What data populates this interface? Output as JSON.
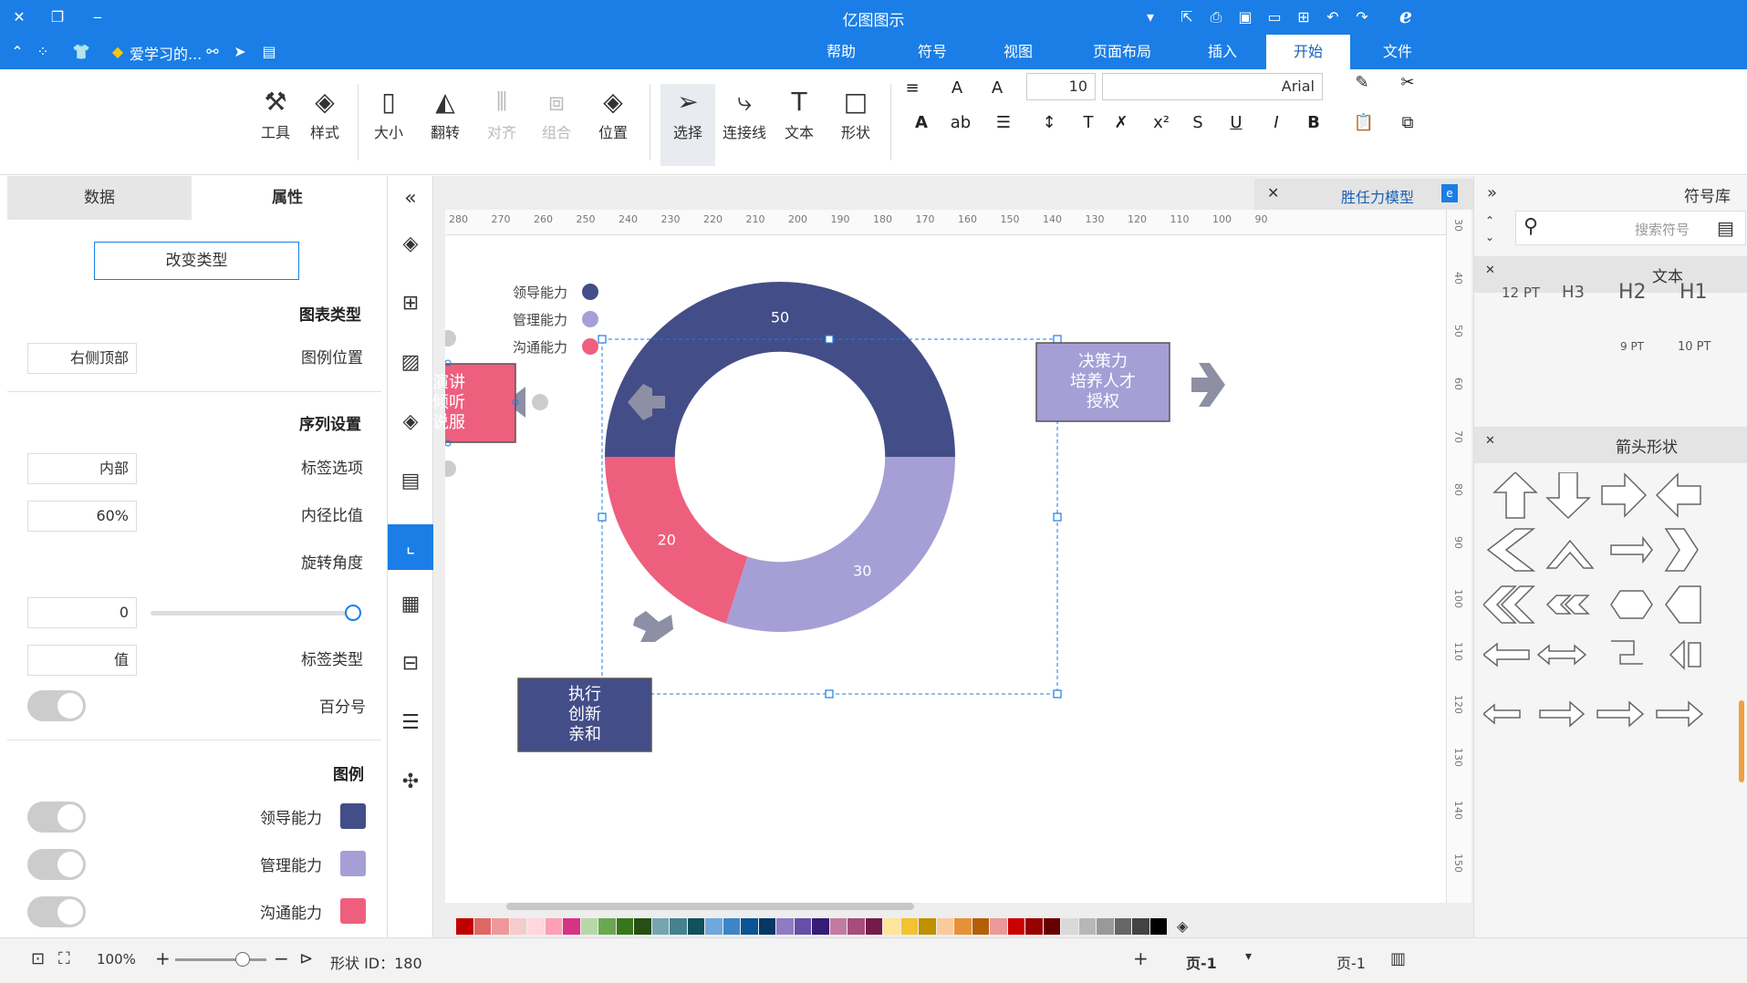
{
  "titlebar": {
    "title": "亿图图示"
  },
  "tabs": [
    {
      "label": "文件"
    },
    {
      "label": "开始"
    },
    {
      "label": "插入"
    },
    {
      "label": "页面布局"
    },
    {
      "label": "视图"
    },
    {
      "label": "符号"
    },
    {
      "label": "帮助"
    }
  ],
  "quickbar": {
    "user_label": "爱学习的..."
  },
  "ribbon": {
    "font_name": "Arial",
    "font_size": "10",
    "buttons": {
      "shape": "形状",
      "text": "文本",
      "connector": "连接线",
      "select": "选择",
      "position": "位置",
      "group": "组合",
      "align": "对齐",
      "flip": "翻转",
      "size": "大小",
      "style": "样式",
      "tools": "工具"
    }
  },
  "left_panel": {
    "tab_properties": "属性",
    "tab_data": "数据",
    "change_type": "改变类型",
    "chart_type_header": "图表类型",
    "legend_position_label": "图例位置",
    "legend_position_value": "右侧顶部",
    "series_header": "序列设置",
    "label_option_label": "标签选项",
    "label_option_value": "内部",
    "inner_ratio_label": "内径比值",
    "inner_ratio_value": "60%",
    "rotation_label": "旋转角度",
    "rotation_value": "0",
    "label_type_label": "标签类型",
    "label_type_value": "值",
    "percent_label": "百分号",
    "legend_header": "图例",
    "legend_items": [
      {
        "name": "领导能力",
        "color": "#434d87"
      },
      {
        "name": "管理能力",
        "color": "#a59fd6"
      },
      {
        "name": "沟通能力",
        "color": "#ee5f7e"
      }
    ]
  },
  "document_tab": {
    "title": "胜任力模型"
  },
  "ruler_top_labels": [
    "280",
    "270",
    "260",
    "250",
    "240",
    "230",
    "220",
    "210",
    "200",
    "190",
    "180",
    "170",
    "160",
    "150",
    "140",
    "130",
    "120",
    "110",
    "100",
    "90"
  ],
  "ruler_right_labels": [
    "30",
    "40",
    "50",
    "60",
    "70",
    "80",
    "90",
    "100",
    "110",
    "120",
    "130",
    "140",
    "150"
  ],
  "chart_data": {
    "type": "donut",
    "title": "",
    "inner_ratio": 0.6,
    "series": [
      {
        "name": "领导能力",
        "value": 50,
        "color": "#434d87"
      },
      {
        "name": "管理能力",
        "value": 30,
        "color": "#a59fd6"
      },
      {
        "name": "沟通能力",
        "value": 20,
        "color": "#ee5f7e"
      }
    ],
    "legend_position": "top-left",
    "value_labels": [
      "50",
      "30",
      "20"
    ]
  },
  "diagram": {
    "box_pink_text": "演讲\n倾听\n说服",
    "box_pink_color": "#ee5f7e",
    "box_purple_text": "决策力\n培养人才\n授权",
    "box_purple_color": "#a59fd6",
    "box_navy_text": "执行\n创新\n亲和",
    "box_navy_color": "#434d87"
  },
  "right_panel": {
    "title": "符号库",
    "search_placeholder": "搜索符号",
    "section_text": "文本",
    "section_arrows": "箭头形状",
    "text_samples": [
      "H1",
      "H2",
      "H3",
      "12 PT",
      "10 PT",
      "9 PT"
    ]
  },
  "statusbar": {
    "page_label": "页-1",
    "page_tab": "页-1",
    "shape_id": "形状 ID：180",
    "zoom": "100%"
  },
  "palette_colors": [
    "#c00000",
    "#e06666",
    "#e99",
    "#f4cccc",
    "#ffd7e0",
    "#ff9fb5",
    "#d63384",
    "#b6d7a8",
    "#6aa84f",
    "#38761d",
    "#274e13",
    "#76a5af",
    "#45818e",
    "#134f5c",
    "#6fa8dc",
    "#3d85c6",
    "#0b5394",
    "#073763",
    "#8e7cc3",
    "#674ea7",
    "#351c75",
    "#c27ba0",
    "#a64d79",
    "#741b47",
    "#ffe599",
    "#f1c232",
    "#bf9000",
    "#f9cb9c",
    "#e69138",
    "#b45f06",
    "#ea9999",
    "#cc0000",
    "#990000",
    "#660000",
    "#d9d9d9",
    "#b7b7b7",
    "#999999",
    "#666666",
    "#434343",
    "#000000"
  ]
}
